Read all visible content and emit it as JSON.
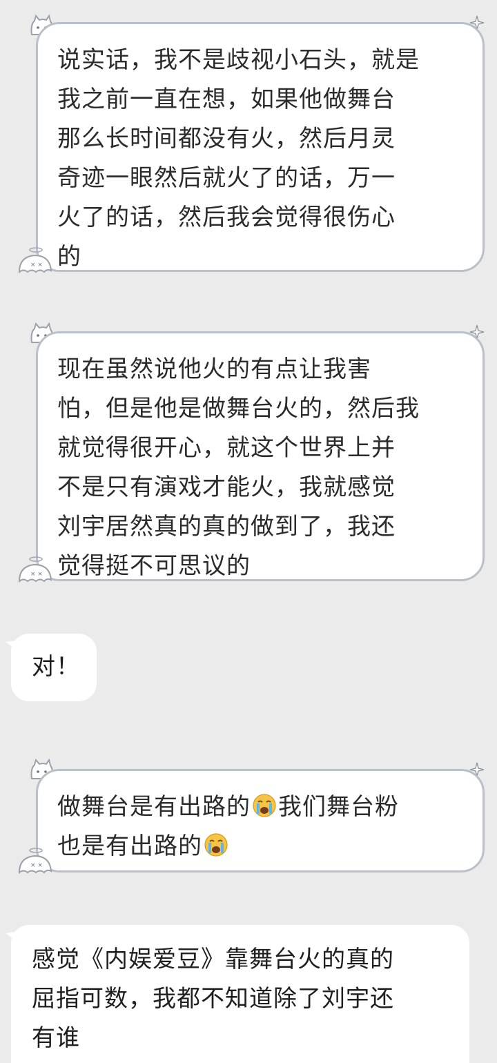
{
  "messages": [
    {
      "side": "sender",
      "text": "说实话，我不是歧视小石头，就是\n我之前一直在想，如果他做舞台\n那么长时间都没有火，然后月灵\n奇迹一眼然后就火了的话，万一\n火了的话，然后我会觉得很伤心\n的"
    },
    {
      "side": "sender",
      "text": "现在虽然说他火的有点让我害\n怕，但是他是做舞台火的，然后我\n就觉得很开心，就这个世界上并\n不是只有演戏才能火，我就感觉\n刘宇居然真的真的做到了，我还\n觉得挺不可思议的"
    },
    {
      "side": "receiver",
      "text": "对！"
    },
    {
      "side": "sender",
      "text_part1": "做舞台是有出路的",
      "emoji1": "loudly-crying-face-emoji",
      "text_part2": "我们舞台粉\n也是有出路的",
      "emoji2": "loudly-crying-face-emoji"
    },
    {
      "side": "receiver",
      "text": "感觉《内娱爱豆》靠舞台火的真的\n屈指可数，我都不知道除了刘宇还\n有谁"
    }
  ],
  "colors": {
    "background": "#ebebeb",
    "bubble": "#ffffff",
    "bubble_border": "#b9c0ca",
    "text": "#2b2b2b"
  }
}
